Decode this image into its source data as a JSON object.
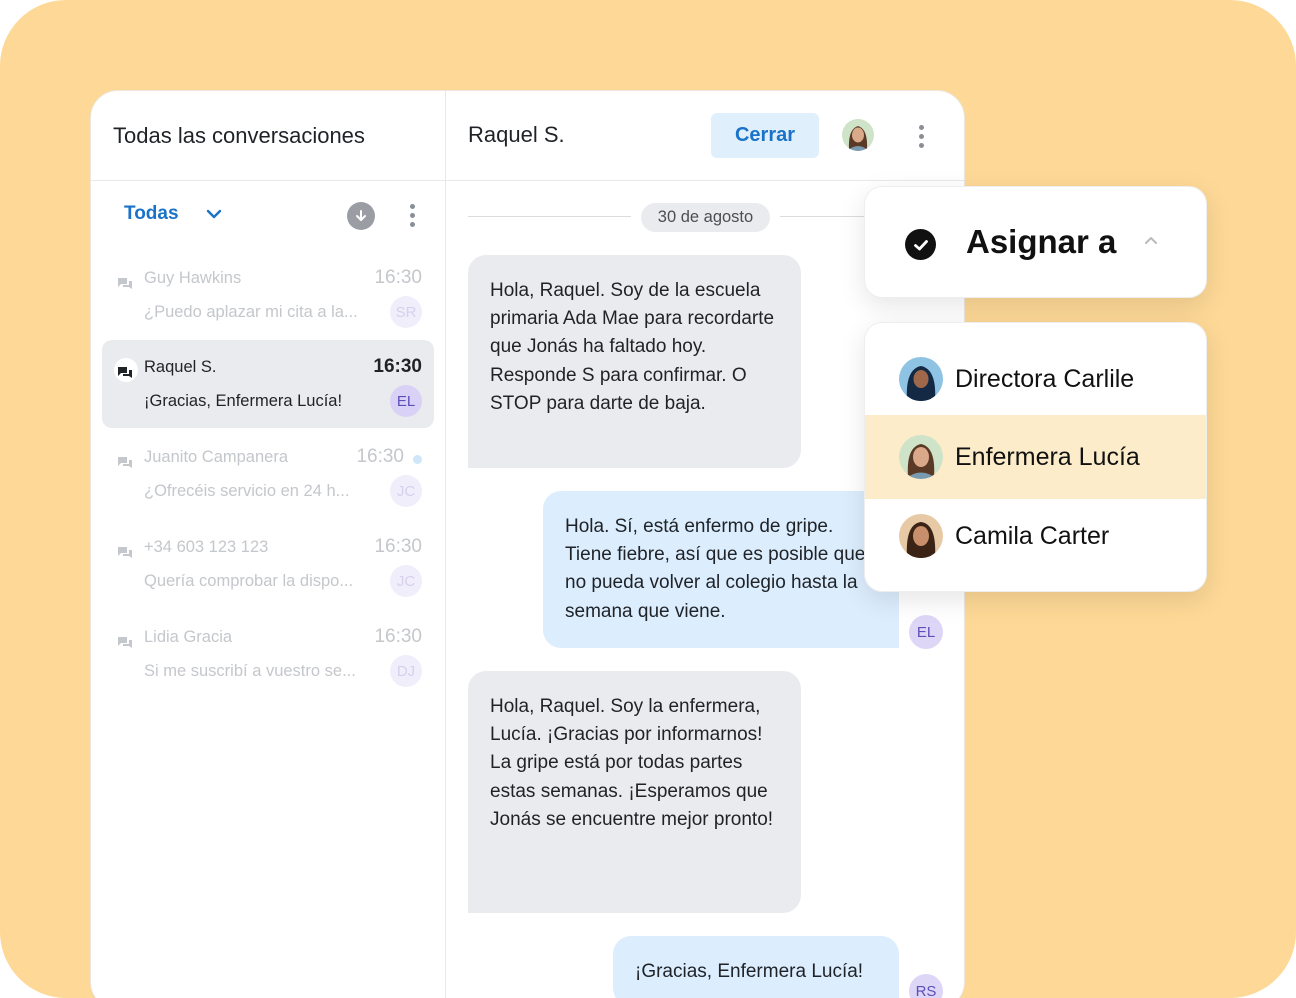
{
  "left": {
    "title": "Todas las conversaciones",
    "filter": "Todas",
    "conversations": [
      {
        "name": "Guy Hawkins",
        "time": "16:30",
        "preview": "¿Puedo aplazar mi cita a la...",
        "initials": "SR",
        "active": false
      },
      {
        "name": "Raquel S.",
        "time": "16:30",
        "preview": "¡Gracias, Enfermera Lucía!",
        "initials": "EL",
        "active": true
      },
      {
        "name": "Juanito Campanera",
        "time": "16:30",
        "preview": "¿Ofrecéis servicio en 24 h...",
        "initials": "JC",
        "active": false,
        "unread": true
      },
      {
        "name": "+34 603 123 123",
        "time": "16:30",
        "preview": "Quería comprobar la dispo...",
        "initials": "JC",
        "active": false
      },
      {
        "name": "Lidia Gracia",
        "time": "16:30",
        "preview": "Si me suscribí a vuestro se...",
        "initials": "DJ",
        "active": false
      }
    ]
  },
  "chat": {
    "title": "Raquel S.",
    "close_label": "Cerrar",
    "date": "30 de agosto",
    "messages": [
      {
        "dir": "in",
        "text": "Hola, Raquel. Soy de la escuela primaria Ada Mae para recordarte que Jonás ha faltado hoy. Responde S para confirmar. O STOP para darte de baja."
      },
      {
        "dir": "out",
        "text": "Hola. Sí, está enfermo de gripe. Tiene fiebre, así que es posible que no pueda volver al colegio hasta la semana que viene.",
        "initials": "EL"
      },
      {
        "dir": "in",
        "text": "Hola, Raquel. Soy la enfermera, Lucía. ¡Gracias por informarnos! La gripe está por todas partes estas semanas. ¡Esperamos que Jonás se encuentre mejor pronto!"
      },
      {
        "dir": "out",
        "text": "¡Gracias, Enfermera Lucía!",
        "initials": "RS"
      }
    ]
  },
  "assign": {
    "title": "Asignar a",
    "people": [
      {
        "name": "Directora Carlile",
        "selected": false
      },
      {
        "name": "Enfermera Lucía",
        "selected": true
      },
      {
        "name": "Camila Carter",
        "selected": false
      }
    ]
  },
  "colors": {
    "background": "#fdd896",
    "accent": "#1a73c8",
    "incoming_bubble": "#e9ebee",
    "outgoing_bubble": "#dcedfd",
    "selected_row": "#fcecca"
  },
  "icons": [
    "chat-icon",
    "chevron-down-icon",
    "download-icon",
    "more-vert-icon",
    "check-circle-icon",
    "chevron-up-icon",
    "avatar"
  ]
}
